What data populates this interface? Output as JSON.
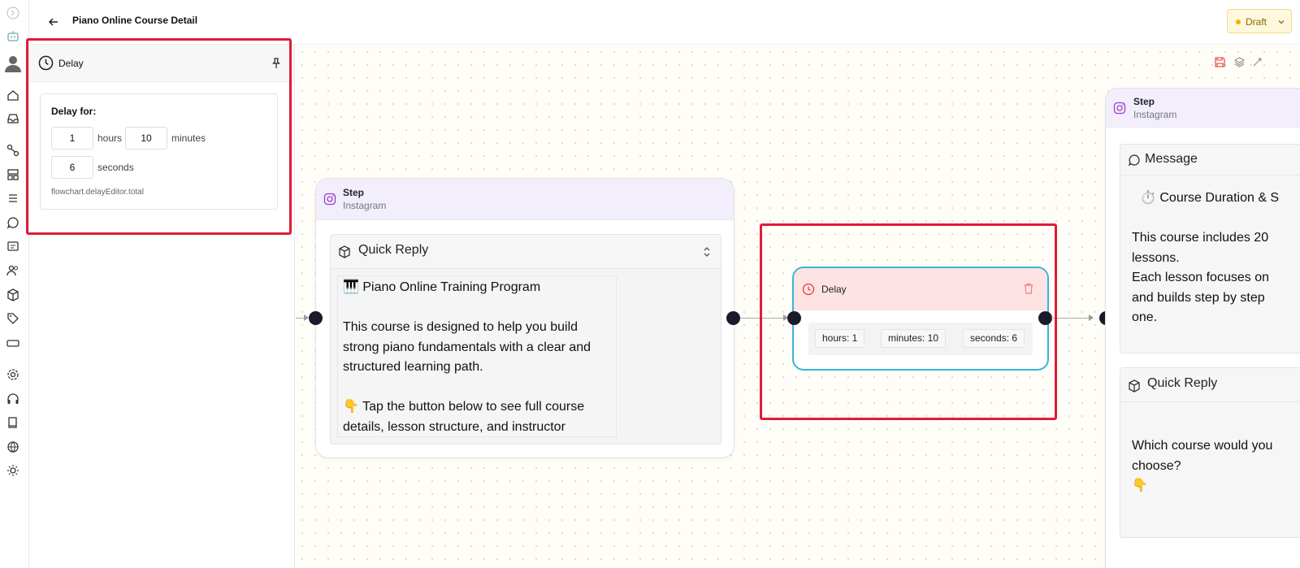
{
  "header": {
    "title": "Piano Online Course Detail",
    "status": "Draft"
  },
  "rail": {
    "icons": [
      "sidebar-toggle-icon",
      "bot-icon",
      "user-avatar-icon",
      "home-icon",
      "inbox-icon",
      "flow-icon",
      "layout-icon",
      "list-icon",
      "chat-icon",
      "comment-icon",
      "users-icon",
      "package-icon",
      "tag-icon",
      "ticket-icon",
      "settings-icon",
      "headset-icon",
      "book-icon",
      "globe-icon",
      "sun-icon"
    ]
  },
  "delay_panel": {
    "title": "Delay",
    "delay_for_label": "Delay for:",
    "hours_value": "1",
    "hours_unit": "hours",
    "minutes_value": "10",
    "minutes_unit": "minutes",
    "seconds_value": "6",
    "seconds_unit": "seconds",
    "total_label": "flowchart.delayEditor.total"
  },
  "step_node_left": {
    "title": "Step",
    "subtitle": "Instagram",
    "block_title": "Quick Reply",
    "body": "🎹 Piano Online Training Program\n\nThis course is designed to help you build strong piano fundamentals with a clear and structured learning path.\n\n👇 Tap the button below to see full course details, lesson structure, and instructor"
  },
  "delay_node": {
    "title": "Delay",
    "hours": "hours: 1",
    "minutes": "minutes: 10",
    "seconds": "seconds: 6"
  },
  "step_node_right": {
    "title": "Step",
    "subtitle": "Instagram",
    "message_title": "Message",
    "message_line": "⏱️ Course Duration & S",
    "message_body": "This course includes 20\nlessons.\nEach lesson focuses on\nand builds step by step\none.",
    "quick_reply_title": "Quick Reply",
    "quick_reply_body": "Which course would you\nchoose?\n👇"
  },
  "colors": {
    "highlight": "#e01b38",
    "delay_border": "#3cb4d6",
    "step_header": "#f2eefc",
    "delay_header": "#fde3e3"
  }
}
